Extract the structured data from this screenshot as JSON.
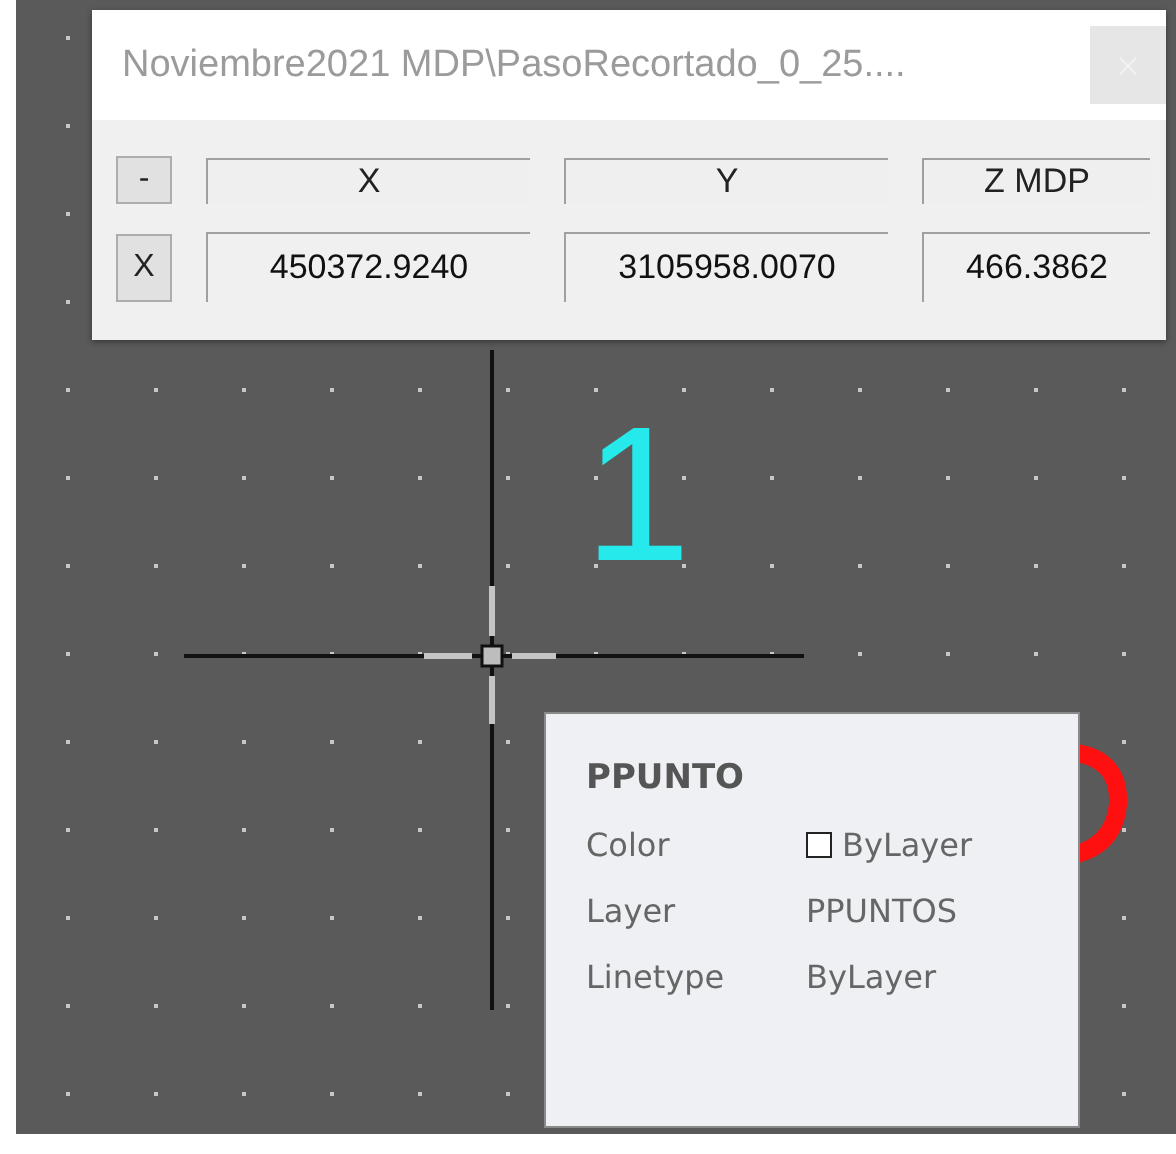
{
  "dialog": {
    "title": "Noviembre2021 MDP\\PasoRecortado_0_25....",
    "collapse_button": "-",
    "clear_button": "X",
    "columns": [
      "X",
      "Y",
      "Z MDP"
    ],
    "values": [
      "450372.9240",
      "3105958.0070",
      "466.3862"
    ]
  },
  "canvas": {
    "labels": [
      "1"
    ]
  },
  "tooltip": {
    "title": "PPUNTO",
    "properties": [
      {
        "label": "Color",
        "value": "ByLayer",
        "kind": "color"
      },
      {
        "label": "Layer",
        "value": "PPUNTOS",
        "kind": "text"
      },
      {
        "label": "Linetype",
        "value": "ByLayer",
        "kind": "text"
      }
    ]
  }
}
